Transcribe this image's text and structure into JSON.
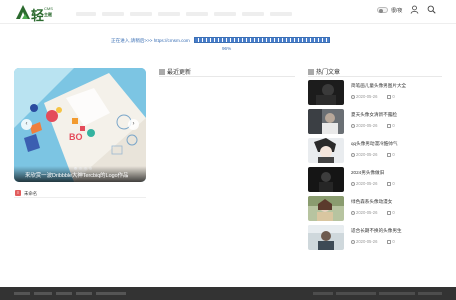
{
  "header": {
    "logo_main": "轻",
    "logo_cms": "CMS",
    "logo_sub": "主题",
    "mode_label": "很/夜",
    "icons": [
      "user-icon",
      "search-icon"
    ],
    "brand_color": "#2b6a2e"
  },
  "redirect": {
    "text": "正在进入,请稍后>>> https://cmsm.com",
    "percent": "96%",
    "progress": 0.96,
    "color": "#3a6fb5"
  },
  "slider": {
    "caption": "来欣赏一波Dribbble大神Tercbiq的Logo作品",
    "prev_label": "‹",
    "next_label": "›",
    "active_index": 0,
    "count": 4
  },
  "small_section": {
    "title": "未命名"
  },
  "latest": {
    "title": "最近更新"
  },
  "hot": {
    "title": "热门文章",
    "items": [
      {
        "title": "简笔画儿童头像男图片大全",
        "date": "2020-05-26",
        "comments": "0"
      },
      {
        "title": "夏天头像女清新不露脸",
        "date": "2020-05-26",
        "comments": "0"
      },
      {
        "title": "qq头像男动漫冷酷帅气",
        "date": "2020-05-26",
        "comments": "0"
      },
      {
        "title": "2024男头像做旧",
        "date": "2020-05-26",
        "comments": "0"
      },
      {
        "title": "绿色森系头像动漫女",
        "date": "2020-05-26",
        "comments": "0"
      },
      {
        "title": "适合长期不换的头像男生",
        "date": "2020-05-26",
        "comments": "0"
      }
    ]
  }
}
